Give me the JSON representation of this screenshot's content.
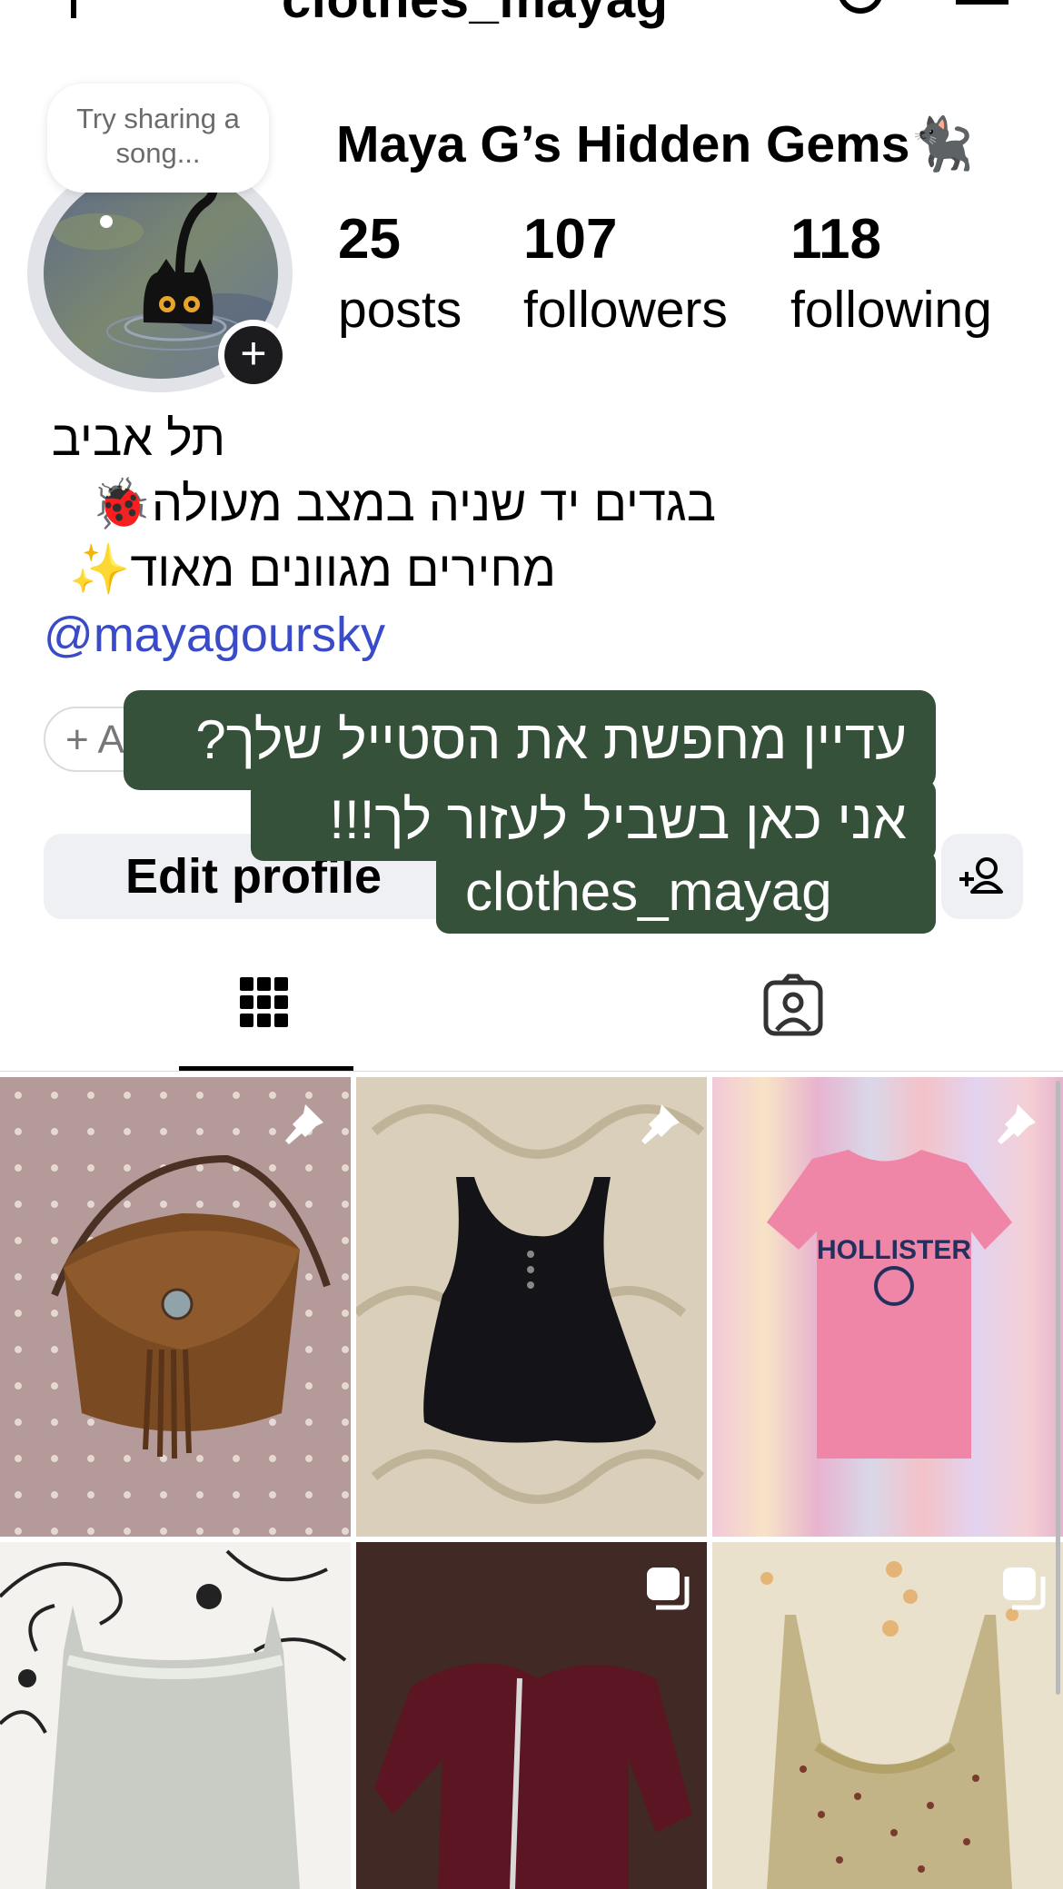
{
  "header": {
    "username": "clothes_mayag"
  },
  "profile": {
    "note": "Try sharing a song...",
    "display_name": "Maya G’s Hidden Gems🐈‍⬛",
    "stats": [
      {
        "value": "25",
        "label": "posts"
      },
      {
        "value": "107",
        "label": "followers"
      },
      {
        "value": "118",
        "label": "following"
      }
    ],
    "bio": {
      "location": "תל אביב",
      "line1": "בגדים יד שניה במצב מעולה🐞",
      "line2": "מחירים מגוונים מאוד✨",
      "mention": "@mayagoursky"
    },
    "add_chip": "+ A"
  },
  "buttons": {
    "edit_profile": "Edit profile"
  },
  "overlay_banner": {
    "line1": "עדיין מחפשת את הסטייל שלך?",
    "line2": "אני כאן בשביל לעזור לך!!!",
    "line3": "clothes_mayag"
  },
  "tabs": [
    {
      "name": "grid",
      "icon": "grid-icon",
      "selected": true
    },
    {
      "name": "tagged",
      "icon": "tagged-person-icon",
      "selected": false
    }
  ],
  "posts": [
    {
      "item": "brown suede saddle bag",
      "badge": "pin-icon"
    },
    {
      "item": "black tank top",
      "badge": "pin-icon"
    },
    {
      "item": "pink Hollister t-shirt",
      "badge": "pin-icon"
    },
    {
      "item": "white lace cami",
      "badge": ""
    },
    {
      "item": "burgundy zip hoodie",
      "badge": "multi-photo-icon"
    },
    {
      "item": "floral slip dress",
      "badge": "multi-photo-icon"
    }
  ],
  "colors": {
    "link": "#3a4bc9",
    "banner": "#365139",
    "button_bg": "#eff0f3"
  }
}
